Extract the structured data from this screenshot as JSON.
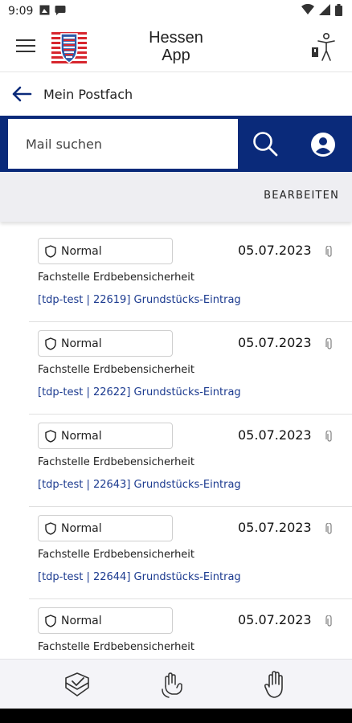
{
  "status_bar": {
    "time": "9:09"
  },
  "app_bar": {
    "title_line1": "Hessen",
    "title_line2": "App"
  },
  "back_bar": {
    "title": "Mein Postfach"
  },
  "search": {
    "placeholder": "Mail suchen"
  },
  "actions": {
    "edit_label": "BEARBEITEN"
  },
  "messages": [
    {
      "priority": "Normal",
      "date": "05.07.2023",
      "sender": "Fachstelle Erdbebensicherheit",
      "subject": "[tdp-test | 22619] Grundstücks-Eintrag"
    },
    {
      "priority": "Normal",
      "date": "05.07.2023",
      "sender": "Fachstelle Erdbebensicherheit",
      "subject": "[tdp-test | 22622] Grundstücks-Eintrag"
    },
    {
      "priority": "Normal",
      "date": "05.07.2023",
      "sender": "Fachstelle Erdbebensicherheit",
      "subject": "[tdp-test | 22643] Grundstücks-Eintrag"
    },
    {
      "priority": "Normal",
      "date": "05.07.2023",
      "sender": "Fachstelle Erdbebensicherheit",
      "subject": "[tdp-test | 22644] Grundstücks-Eintrag"
    },
    {
      "priority": "Normal",
      "date": "05.07.2023",
      "sender": "Fachstelle Erdbebensicherheit",
      "subject": ""
    }
  ],
  "colors": {
    "brand_blue": "#0a2a7a",
    "link_blue": "#1b3a8f",
    "flag_red": "#d7262e"
  },
  "icons": {
    "menu": "hamburger-icon",
    "logo": "hessen-coat-of-arms",
    "accessibility": "accessibility-person-icon",
    "back": "arrow-left-icon",
    "search": "search-icon",
    "profile": "account-circle-icon",
    "priority": "shield-icon",
    "attachment": "paperclip-icon",
    "nav1": "checked-layers-icon",
    "nav2": "sign-language-icon",
    "nav3": "hand-icon"
  }
}
